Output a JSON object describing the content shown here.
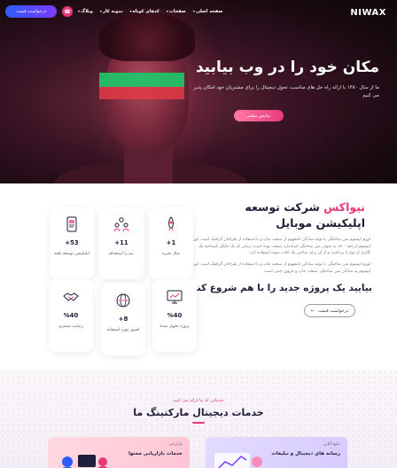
{
  "header": {
    "brand": "NIWAX",
    "nav": [
      {
        "label": "صفحه اصلی",
        "dropdown": true
      },
      {
        "label": "صفحات",
        "dropdown": true
      },
      {
        "label": "کدهای کوتاه",
        "dropdown": true
      },
      {
        "label": "نمونه کار",
        "dropdown": true
      },
      {
        "label": "وبلاگ",
        "dropdown": true
      }
    ],
    "call_icon": "phone-icon",
    "quote_button": "درخواست قیمت"
  },
  "hero": {
    "title": "مکان خود را در وب بیابید",
    "description": "ما از سال ۱۳۸۰ با ارائه راه حل های مناسب، تحول دیجیتال را برای مشتریان خود امکان پذیر می کنیم",
    "button": "نمایش بیشتر"
  },
  "about": {
    "brand_word": "نیواکس",
    "title_rest": "شرکت توسعه اپلیکیشن موبایل",
    "paragraph1": "لورم ایپسوم متن ساختگی با تولید سادگی نامفهوم از صنعت چاپ و با استفاده از طراحان گرافیک است. لورم ایپسوم از دهه ۱۵۰۰ به عنوان متن ساختگی استاندارد صنعت بوده است، زمانی که یک چاپگر ناشناخته یک گالری از نوع را برداشت و از آن برای ساختن یک کتاب نمونه استفاده کرد.",
    "paragraph2": "لورم ایپسوم متن ساختگی با تولید سادگی نامفهوم از صنعت چاپ و با استفاده از طراحان گرافیک است. لورم ایپسوم به سادگی متن ساختگی صنعت چاپ و حروف چینی است.",
    "cta_title": "بیایید یک پروژه جدید را با هم شروع کنیم",
    "cta_button": "درخواست قیمت",
    "stats": [
      {
        "value": "+1",
        "label": "سال تجربه",
        "icon": "rocket-icon"
      },
      {
        "value": "+11",
        "label": "تیم را استخدام",
        "icon": "team-icon"
      },
      {
        "value": "+53",
        "label": "اپلیکیشن توسعه یافته",
        "icon": "mobile-app-icon"
      },
      {
        "value": "%40",
        "label": "پروژه تحویل شده",
        "icon": "monitor-icon"
      },
      {
        "value": "+8",
        "label": "کشور مورد استفاده",
        "icon": "globe-icon"
      },
      {
        "value": "%40",
        "label": "رضایت مشتری",
        "icon": "handshake-icon"
      }
    ]
  },
  "services": {
    "subtitle": "خدماتی که ما ارائه می کنیم",
    "title": "خدمات دیجیتال مارکتینگ ما",
    "cards": [
      {
        "tag": "تبلیغ آنلاین",
        "name": "رسانه های دیجیتال و تبلیغات"
      },
      {
        "tag": "بازاریابی",
        "name": "خدمات بازاریابی محتوا"
      }
    ]
  },
  "colors": {
    "accent_pink": "#e8387a",
    "accent_blue": "#2f5bff",
    "dark": "#1f1f3a"
  }
}
